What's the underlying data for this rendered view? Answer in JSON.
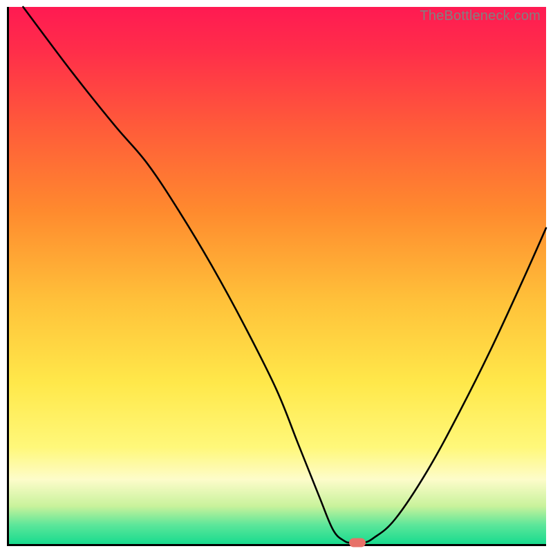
{
  "watermark": "TheBottleneck.com",
  "colors": {
    "gradient_stops": [
      {
        "pos": 0.0,
        "color": "#ff1a52"
      },
      {
        "pos": 0.08,
        "color": "#ff2d4a"
      },
      {
        "pos": 0.22,
        "color": "#ff5a3a"
      },
      {
        "pos": 0.38,
        "color": "#ff8a2e"
      },
      {
        "pos": 0.55,
        "color": "#ffc23a"
      },
      {
        "pos": 0.7,
        "color": "#ffe84a"
      },
      {
        "pos": 0.82,
        "color": "#fff87a"
      },
      {
        "pos": 0.88,
        "color": "#fdfcca"
      },
      {
        "pos": 0.93,
        "color": "#c8f29b"
      },
      {
        "pos": 0.965,
        "color": "#5be69a"
      },
      {
        "pos": 1.0,
        "color": "#18db8e"
      }
    ],
    "curve": "#000000",
    "marker": "#e77168",
    "axis": "#000000"
  },
  "chart_data": {
    "type": "line",
    "title": "",
    "xlabel": "",
    "ylabel": "",
    "xlim": [
      0,
      100
    ],
    "ylim": [
      0,
      100
    ],
    "grid": false,
    "legend": false,
    "series": [
      {
        "name": "bottleneck-curve",
        "x": [
          3,
          12,
          20,
          26,
          32,
          38,
          44,
          50,
          54,
          58,
          60.5,
          62.5,
          64,
          66,
          68,
          72,
          78,
          84,
          90,
          96,
          100
        ],
        "y": [
          100,
          88,
          78,
          71,
          62,
          52,
          41,
          29,
          19,
          9,
          3,
          1,
          0.6,
          0.6,
          1.5,
          5,
          14,
          25,
          37,
          50,
          59
        ]
      }
    ],
    "annotations": [
      {
        "name": "optimal-marker",
        "x": 65,
        "y": 0.6,
        "shape": "pill",
        "color": "#e77168"
      }
    ],
    "background": "vertical-gradient-rainbow"
  }
}
